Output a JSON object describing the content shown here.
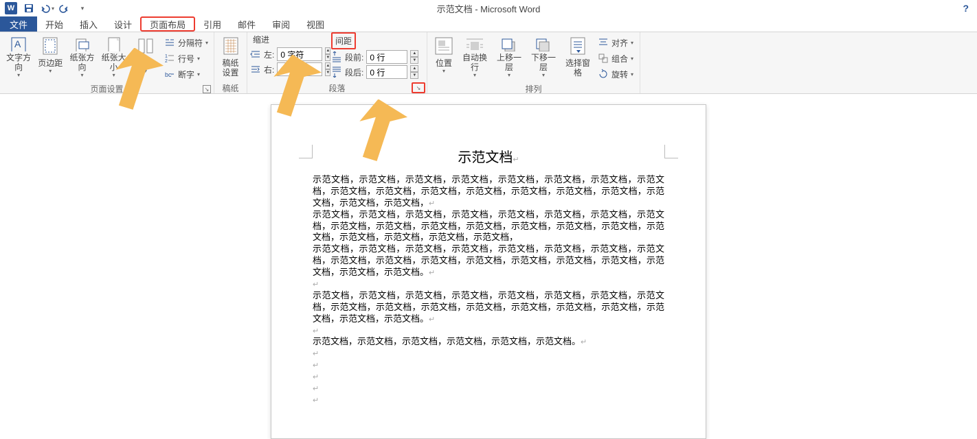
{
  "app": {
    "title": "示范文档 - Microsoft Word"
  },
  "qat": {
    "save": "保存",
    "undo": "撤销",
    "redo": "重做"
  },
  "tabs": {
    "file": "文件",
    "home": "开始",
    "insert": "插入",
    "design": "设计",
    "layout": "页面布局",
    "references": "引用",
    "mailings": "邮件",
    "review": "审阅",
    "view": "视图"
  },
  "ribbon": {
    "pageSetup": {
      "textDirection": "文字方向",
      "margins": "页边距",
      "orientation": "纸张方向",
      "size": "纸张大小",
      "columns": "分栏",
      "breaks": "分隔符",
      "lineNumbers": "行号",
      "hyphenation": "断字",
      "groupLabel": "页面设置"
    },
    "manuscript": {
      "settings": "稿纸\n设置",
      "groupLabel": "稿纸"
    },
    "paragraph": {
      "indentHeader": "缩进",
      "spacingHeader": "间距",
      "leftLabel": "左:",
      "leftValue": "0 字符",
      "rightLabel": "右:",
      "rightValue": "0 字符",
      "beforeLabel": "段前:",
      "beforeValue": "0 行",
      "afterLabel": "段后:",
      "afterValue": "0 行",
      "groupLabel": "段落"
    },
    "arrange": {
      "position": "位置",
      "wrap": "自动换行",
      "bringForward": "上移一层",
      "sendBackward": "下移一层",
      "selectionPane": "选择窗格",
      "align": "对齐",
      "group": "组合",
      "rotate": "旋转",
      "groupLabel": "排列"
    }
  },
  "doc": {
    "title": "示范文档",
    "p1": "示范文档，示范文档，示范文档，示范文档，示范文档，示范文档，示范文档，示范文档，示范文档，示范文档，示范文档，示范文档，示范文档，示范文档，示范文档，示范文档，示范文档，示范文档，",
    "p2": "示范文档，示范文档，示范文档，示范文档，示范文档，示范文档，示范文档，示范文档，示范文档，示范文档，示范文档，示范文档，示范文档，示范文档，示范文档，示范文档，示范文档，示范文档，示范文档，示范文档，",
    "p3": "示范文档，示范文档，示范文档，示范文档，示范文档，示范文档，示范文档，示范文档，示范文档，示范文档，示范文档，示范文档，示范文档，示范文档，示范文档，示范文档，示范文档，示范文档。",
    "p4": "示范文档，示范文档，示范文档，示范文档，示范文档，示范文档，示范文档，示范文档，示范文档，示范文档，示范文档，示范文档，示范文档，示范文档，示范文档，示范文档，示范文档，示范文档。",
    "p5": "示范文档，示范文档，示范文档，示范文档，示范文档，示范文档。"
  }
}
